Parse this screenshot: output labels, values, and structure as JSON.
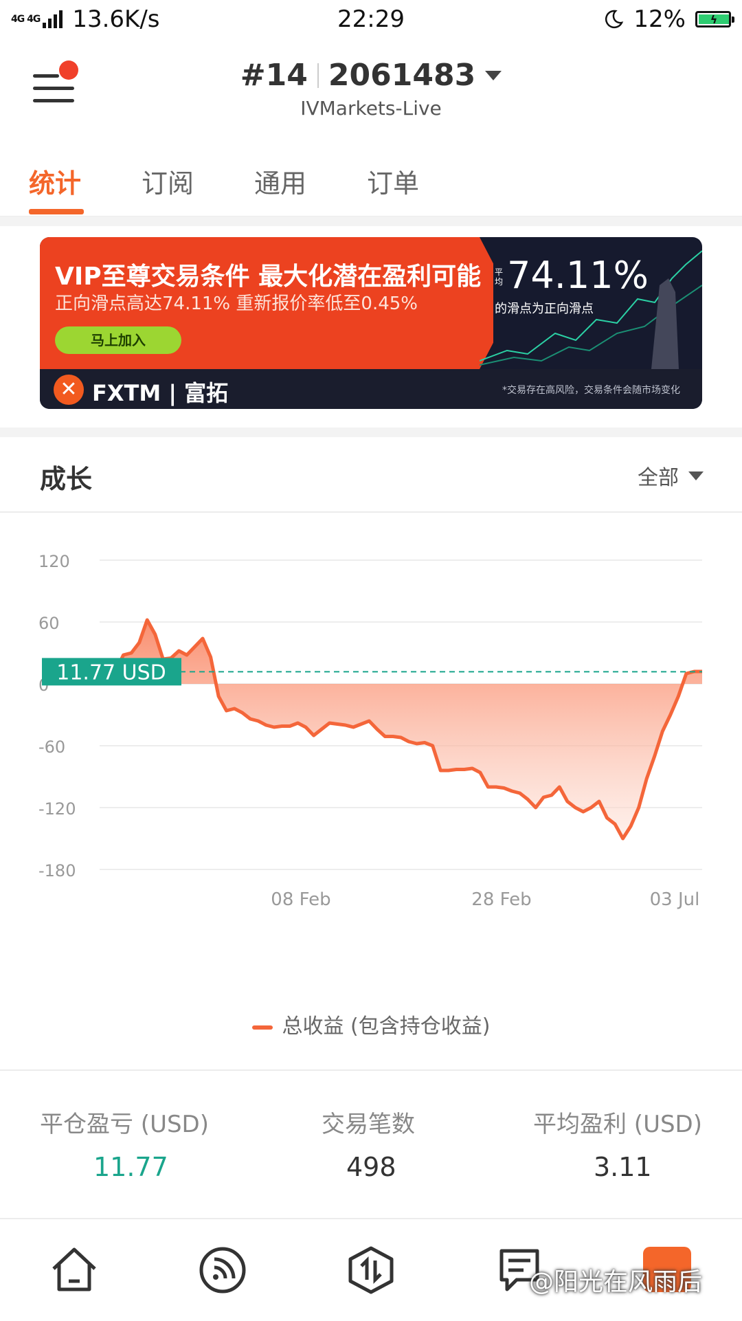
{
  "status_bar": {
    "network": "4G 4G",
    "speed": "13.6K/s",
    "time": "22:29",
    "battery": "12%"
  },
  "header": {
    "account_index": "#14",
    "account_number": "2061483",
    "server": "IVMarkets-Live"
  },
  "tabs": [
    {
      "label": "统计",
      "active": true
    },
    {
      "label": "订阅",
      "active": false
    },
    {
      "label": "通用",
      "active": false
    },
    {
      "label": "订单",
      "active": false
    }
  ],
  "banner": {
    "title": "VIP至尊交易条件 最大化潜在盈利可能",
    "subtitle": "正向滑点高达74.11% 重新报价率低至0.45%",
    "cta": "马上加入",
    "percent_label": "平均",
    "percent": "74.11%",
    "percent_desc": "的滑点为正向滑点",
    "brand": "FXTM | 富拓",
    "disclaimer": "*交易存在高风险，交易条件会随市场变化",
    "colors": {
      "primary": "#ec4220",
      "dark": "#161a2e",
      "cta": "#9cd632"
    }
  },
  "section": {
    "title": "成长",
    "filter": "全部"
  },
  "chart_data": {
    "type": "area",
    "y_ticks": [
      "120",
      "60",
      "0",
      "-60",
      "-120",
      "-180"
    ],
    "ylim": [
      -180,
      120
    ],
    "x_ticks": [
      "08 Feb",
      "28 Feb",
      "03 Jul"
    ],
    "current_label": "11.77 USD",
    "current_value": 11.77,
    "series": [
      {
        "name": "总收益 (包含持仓收益)",
        "color": "#f4663a",
        "values": [
          0,
          4,
          12,
          28,
          30,
          40,
          62,
          48,
          24,
          25,
          32,
          28,
          36,
          44,
          26,
          -12,
          -26,
          -24,
          -28,
          -34,
          -36,
          -40,
          -42,
          -41,
          -41,
          -38,
          -42,
          -50,
          -44,
          -38,
          -39,
          -40,
          -42,
          -39,
          -36,
          -44,
          -51,
          -51,
          -52,
          -56,
          -58,
          -57,
          -60,
          -84,
          -84,
          -83,
          -83,
          -82,
          -86,
          -100,
          -100,
          -101,
          -104,
          -106,
          -112,
          -120,
          -110,
          -108,
          -100,
          -114,
          -120,
          -124,
          -120,
          -114,
          -130,
          -136,
          -150,
          -138,
          -120,
          -92,
          -70,
          -46,
          -30,
          -12,
          10,
          12,
          12
        ]
      }
    ]
  },
  "stats": [
    {
      "label": "平仓盈亏 (USD)",
      "value": "11.77",
      "color": "#1aa58c"
    },
    {
      "label": "交易笔数",
      "value": "498",
      "color": "#333333"
    },
    {
      "label": "平均盈利 (USD)",
      "value": "3.11",
      "color": "#333333"
    }
  ],
  "nav": [
    "home-icon",
    "feed-icon",
    "trade-icon",
    "news-icon",
    "market-icon"
  ],
  "watermark": "@阳光在风雨后"
}
